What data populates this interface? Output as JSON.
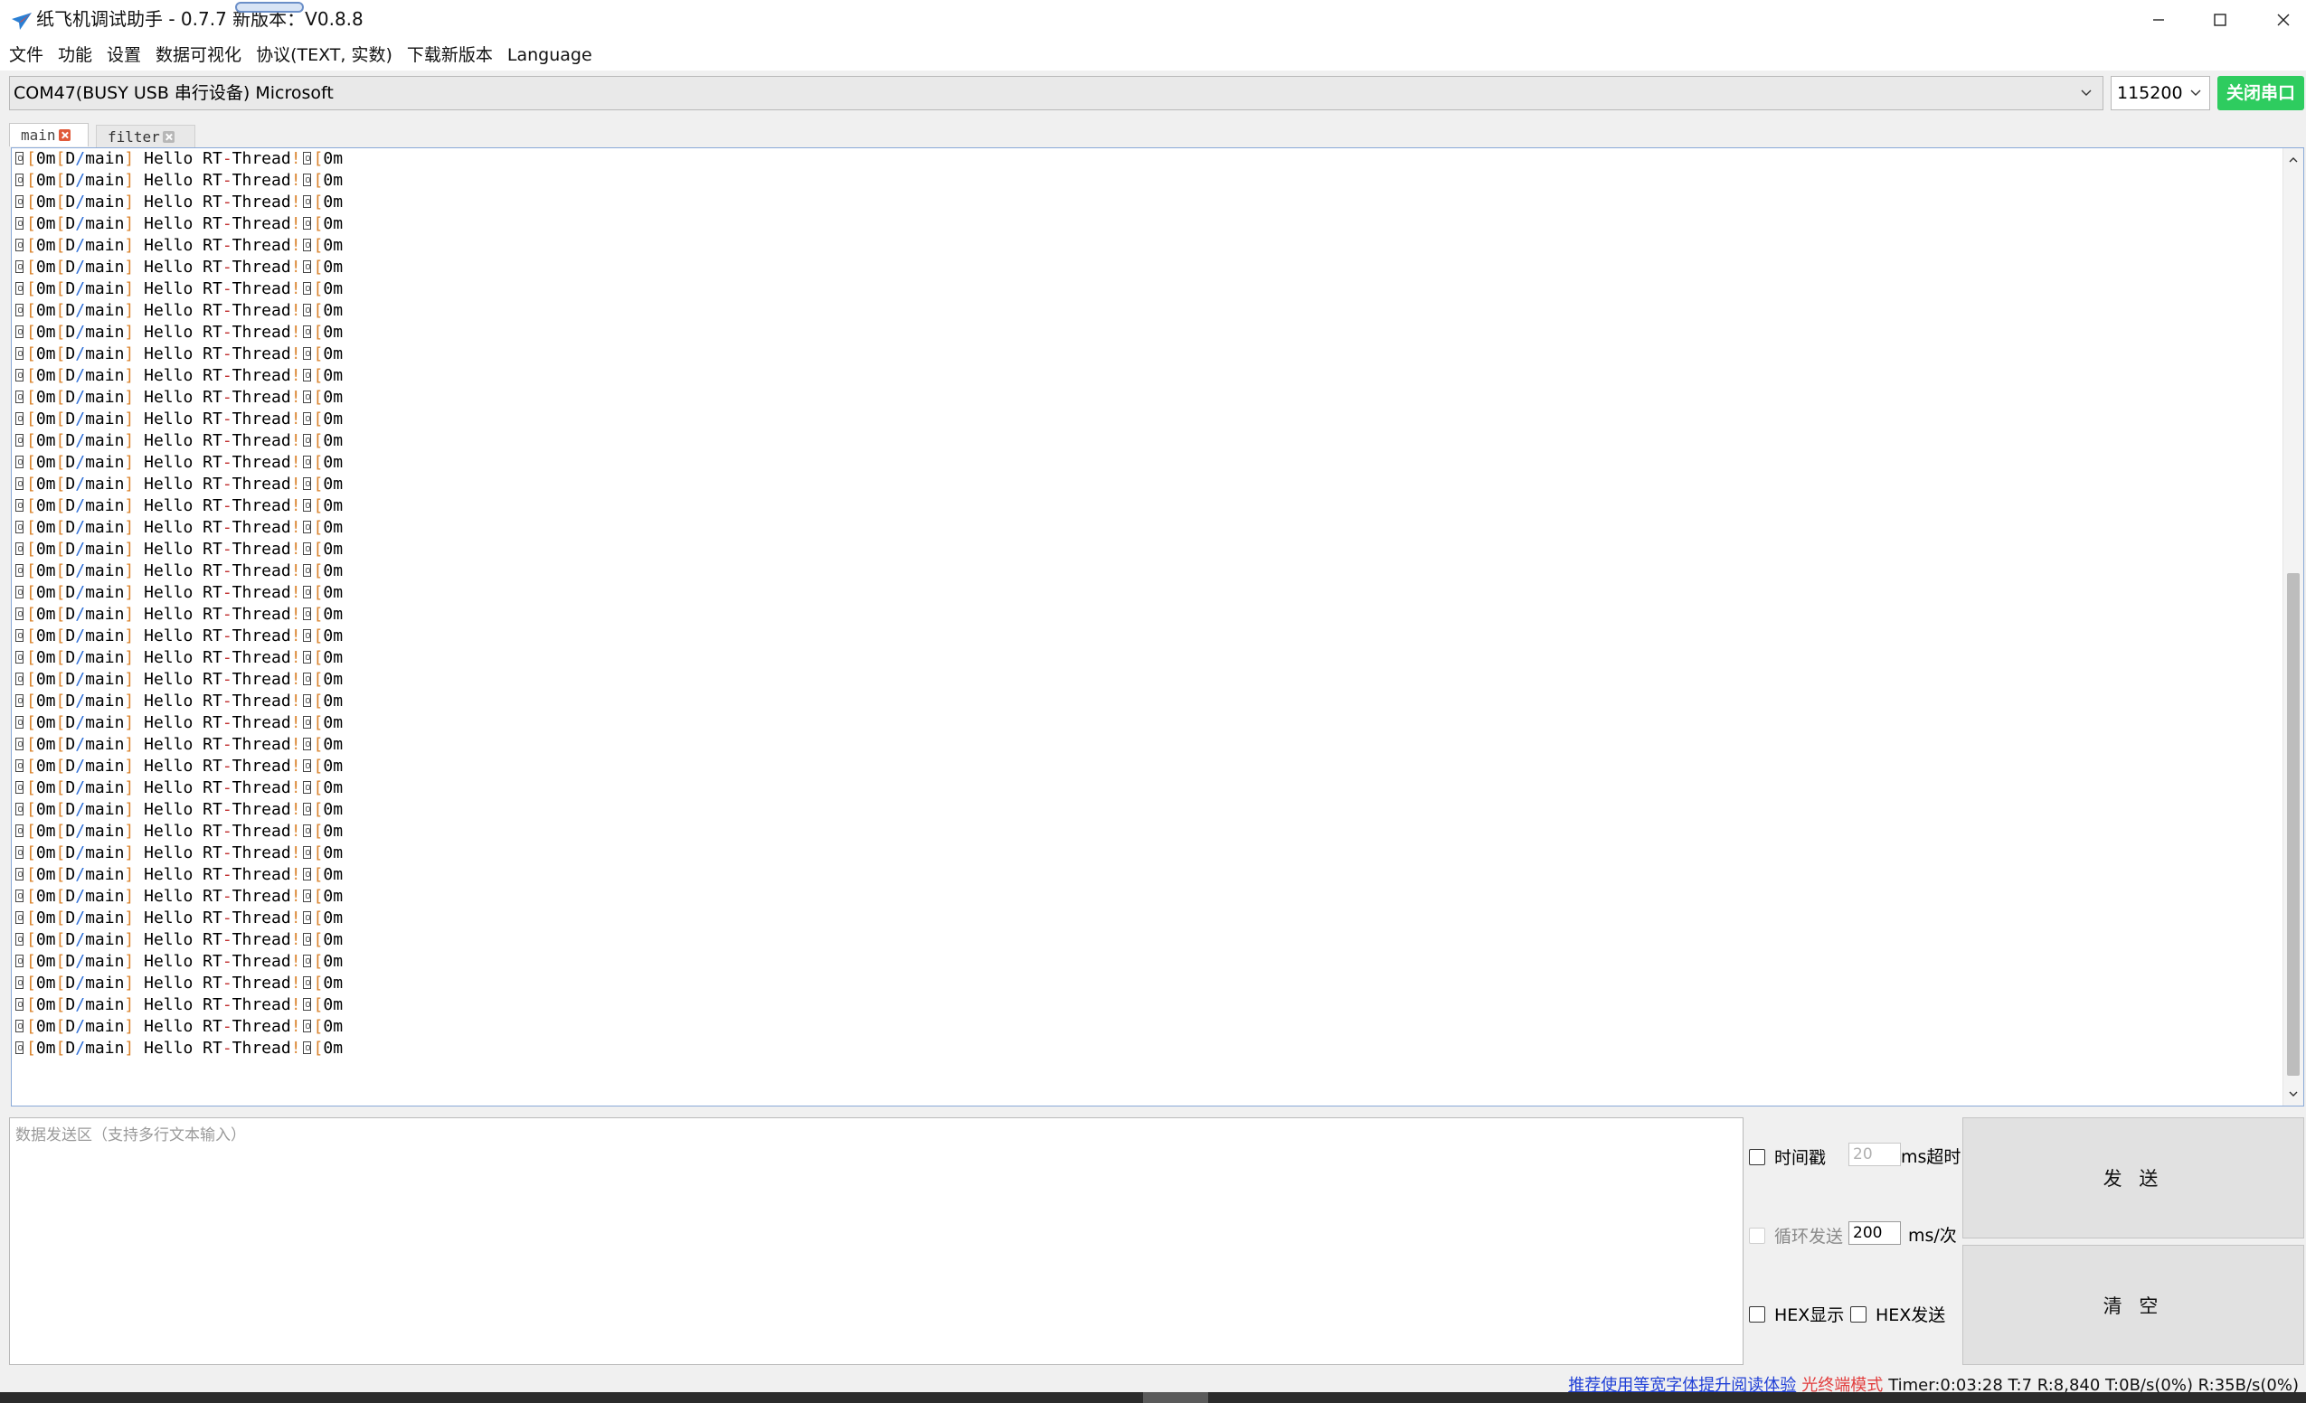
{
  "window": {
    "title": "纸飞机调试助手 - 0.7.7 新版本：V0.8.8",
    "controls": {
      "minimize": "minimize-icon",
      "maximize": "maximize-icon",
      "close": "close-icon"
    }
  },
  "menu": {
    "items": [
      "文件",
      "功能",
      "设置",
      "数据可视化",
      "协议(TEXT, 实数)",
      "下载新版本",
      "Language"
    ]
  },
  "port": {
    "selected": "COM47(BUSY  USB 串行设备) Microsoft",
    "baud": "115200",
    "close_button": "关闭串口",
    "close_button_color": "#2ecc5f"
  },
  "tabs": [
    {
      "label": "main",
      "active": true
    },
    {
      "label": "filter",
      "active": false
    }
  ],
  "terminal": {
    "line_parts": {
      "esc_open": "[",
      "reset": "0m",
      "level": "D",
      "tag": "main",
      "message_hello": "Hello",
      "message_rt": "RT",
      "message_thread": "Thread",
      "excl": "!",
      "tail": "[",
      "tail_reset": "0m"
    },
    "line_count": 42,
    "colors": {
      "bracket": "#d9822b",
      "slash": "#2f6fd6",
      "dash": "#c03030"
    }
  },
  "send": {
    "placeholder": "数据发送区（支持多行文本输入）",
    "timestamp_label": "时间戳",
    "timeout_value": "20",
    "timeout_unit": "ms超时",
    "loop_label": "循环发送",
    "loop_value": "200",
    "loop_unit": "ms/次",
    "hex_display_label": "HEX显示",
    "hex_send_label": "HEX发送",
    "send_button": "发 送",
    "clear_button": "清 空"
  },
  "status": {
    "tip": "推荐使用等宽字体提升阅读体验",
    "mode": "光终端模式",
    "stats": "Timer:0:03:28 T:7 R:8,840  T:0B/s(0%) R:35B/s(0%)"
  }
}
